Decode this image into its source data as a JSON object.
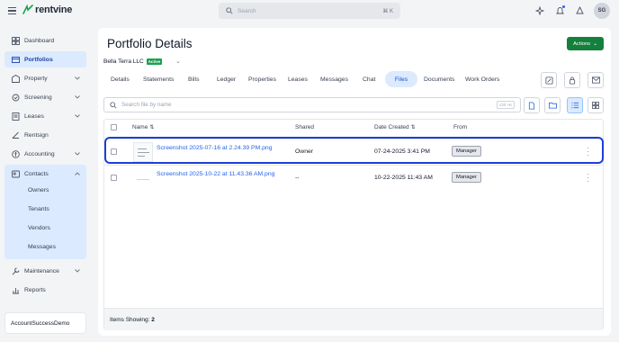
{
  "brand": {
    "name": "rentvine"
  },
  "search": {
    "placeholder": "Search",
    "shortcut": "⌘ K"
  },
  "user": {
    "initials": "SG"
  },
  "sidebar": {
    "items": [
      {
        "label": "Dashboard",
        "icon": "dashboard-icon"
      },
      {
        "label": "Portfolios",
        "icon": "portfolio-icon",
        "active": true
      },
      {
        "label": "Property",
        "icon": "property-icon",
        "expandable": true
      },
      {
        "label": "Screening",
        "icon": "screening-icon",
        "expandable": true
      },
      {
        "label": "Leases",
        "icon": "leases-icon",
        "expandable": true
      },
      {
        "label": "Rentsign",
        "icon": "rentsign-icon"
      },
      {
        "label": "Accounting",
        "icon": "accounting-icon",
        "expandable": true
      },
      {
        "label": "Contacts",
        "icon": "contacts-icon",
        "expanded": true
      },
      {
        "label": "Maintenance",
        "icon": "maintenance-icon",
        "expandable": true
      },
      {
        "label": "Reports",
        "icon": "reports-icon"
      }
    ],
    "contacts_sub": [
      "Owners",
      "Tenants",
      "Vendors",
      "Messages"
    ],
    "account": "AccountSuccessDemo"
  },
  "page": {
    "title": "Portfolio Details",
    "actions_label": "Actions",
    "entity_name": "Bella Terra LLC",
    "entity_status": "Active"
  },
  "tabs": [
    "Details",
    "Statements",
    "Bills",
    "Ledger",
    "Properties",
    "Leases",
    "Messages",
    "Chat",
    "Files",
    "Documents",
    "Work Orders"
  ],
  "active_tab": "Files",
  "files": {
    "search_placeholder": "Search file by name",
    "search_shortcut": "Ctrl +K",
    "columns": {
      "name": "Name",
      "shared": "Shared",
      "date": "Date Created",
      "from": "From"
    },
    "rows": [
      {
        "name": "Screenshot 2025-07-16 at 2.24.39 PM.png",
        "shared": "Owner",
        "date": "07-24-2025 3:41 PM",
        "from": "Manager",
        "highlighted": true
      },
      {
        "name": "Screenshot 2025-10-22 at 11.43.36 AM.png",
        "shared": "--",
        "date": "10-22-2025 11:43 AM",
        "from": "Manager"
      }
    ],
    "footer_label": "Items Showing:",
    "footer_count": "2"
  },
  "colors": {
    "accent": "#2563eb",
    "actions_green": "#15803d",
    "active_badge": "#16a34a",
    "highlight_border": "#1d3fd6"
  }
}
